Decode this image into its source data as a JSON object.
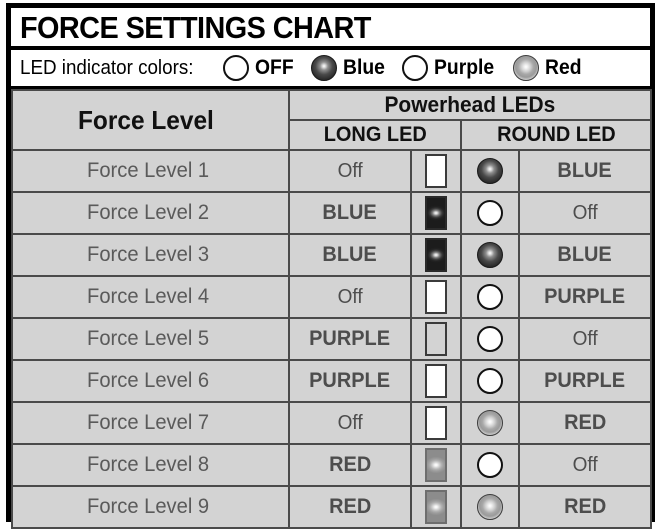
{
  "title": "FORCE SETTINGS CHART",
  "legend": {
    "label": "LED indicator colors:",
    "items": [
      {
        "name": "OFF",
        "state": "off",
        "icon": "led-circle-off-icon"
      },
      {
        "name": "Blue",
        "state": "blue",
        "icon": "led-circle-blue-icon"
      },
      {
        "name": "Purple",
        "state": "purple",
        "icon": "led-circle-purple-icon"
      },
      {
        "name": "Red",
        "state": "red",
        "icon": "led-circle-red-icon"
      }
    ]
  },
  "table": {
    "headers": {
      "force_level": "Force Level",
      "group": "Powerhead LEDs",
      "long_led": "LONG LED",
      "round_led": "ROUND LED"
    },
    "rows": [
      {
        "level": "Force Level 1",
        "long_text": "Off",
        "long_state": "off-white",
        "round_state": "blue",
        "round_text": "BLUE",
        "shaded": true
      },
      {
        "level": "Force Level 2",
        "long_text": "BLUE",
        "long_state": "blue",
        "round_state": "off",
        "round_text": "Off",
        "shaded": false
      },
      {
        "level": "Force Level 3",
        "long_text": "BLUE",
        "long_state": "blue",
        "round_state": "blue",
        "round_text": "BLUE",
        "shaded": true
      },
      {
        "level": "Force Level 4",
        "long_text": "Off",
        "long_state": "off-white",
        "round_state": "off",
        "round_text": "PURPLE",
        "shaded": false
      },
      {
        "level": "Force Level 5",
        "long_text": "PURPLE",
        "long_state": "off-clear",
        "round_state": "off",
        "round_text": "Off",
        "shaded": true
      },
      {
        "level": "Force Level 6",
        "long_text": "PURPLE",
        "long_state": "off-white",
        "round_state": "off",
        "round_text": "PURPLE",
        "shaded": false
      },
      {
        "level": "Force Level 7",
        "long_text": "Off",
        "long_state": "off-white",
        "round_state": "red",
        "round_text": "RED",
        "shaded": true
      },
      {
        "level": "Force Level 8",
        "long_text": "RED",
        "long_state": "red",
        "round_state": "off",
        "round_text": "Off",
        "shaded": false
      },
      {
        "level": "Force Level 9",
        "long_text": "RED",
        "long_state": "red",
        "round_state": "red",
        "round_text": "RED",
        "shaded": true
      }
    ]
  },
  "colors": {
    "frame": "#000000",
    "grid": "#4a4a4a",
    "row_shaded": "#d3d3d3",
    "row_plain": "#ffffff",
    "level_text": "#5a5a5a",
    "value_text": "#4d4d4d",
    "header_text": "#111111"
  }
}
